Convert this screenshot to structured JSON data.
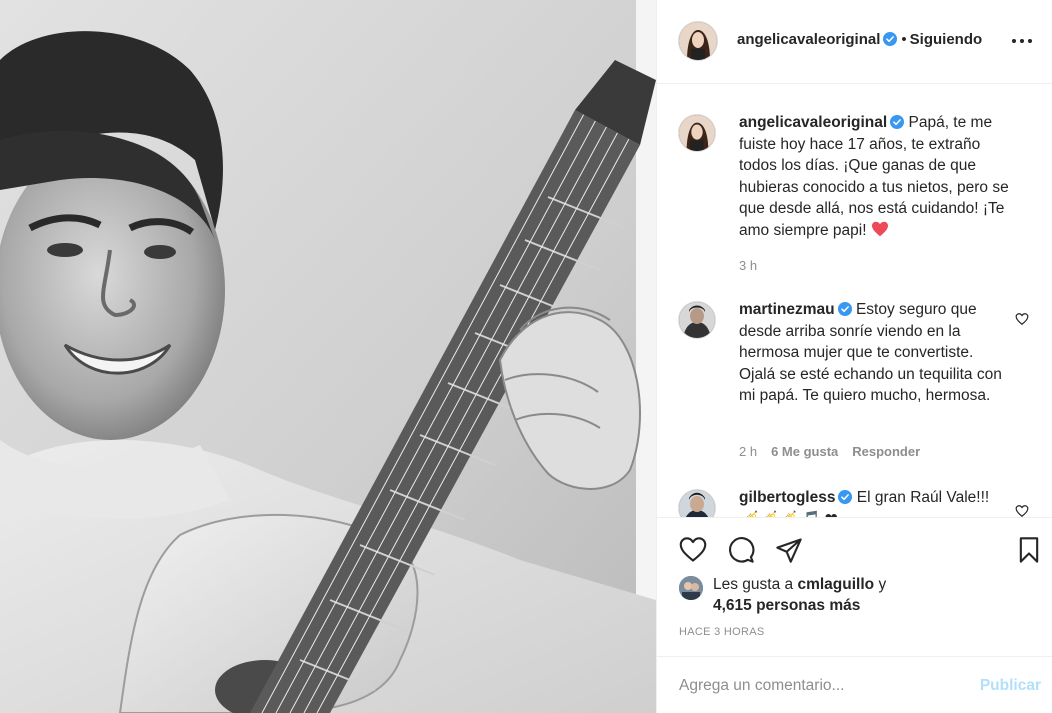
{
  "post": {
    "author": "angelicavaleoriginal",
    "follow_sep": "•",
    "follow_label": "Siguiendo",
    "caption": "Papá, te me fuiste hoy hace 17 años, te extraño todos los días. ¡Que ganas de que hubieras conocido a tus nietos, pero se que desde allá, nos está cuidando! ¡Te amo siempre papi!",
    "caption_time": "3 h"
  },
  "comments": [
    {
      "user": "martinezmau",
      "text": "Estoy seguro que desde arriba sonríe viendo en la hermosa mujer que te convertiste. Ojalá se esté echando un tequilita con mi papá. Te quiero mucho, hermosa.",
      "time": "2 h",
      "likes": "6 Me gusta",
      "reply": "Responder"
    },
    {
      "user": "gilbertogless",
      "text": "El gran Raúl",
      "truncated": "Vale!!! 🎺🎺🎺 🎵 ❤"
    }
  ],
  "likes": {
    "prefix": "Les gusta a",
    "user": "cmlaguillo",
    "and": "y",
    "count": "4,615 personas más"
  },
  "timestamp": "HACE 3 HORAS",
  "add_comment": {
    "placeholder": "Agrega un comentario...",
    "publish_label": "Publicar"
  },
  "icons": {
    "like": "heart-outline-icon",
    "comment": "comment-bubble-icon",
    "share": "paper-plane-icon",
    "save": "bookmark-icon",
    "more": "more-horizontal-icon",
    "verified": "verified-badge-icon"
  },
  "colors": {
    "verified": "#3897f0",
    "publish_disabled": "#b2dffc",
    "heart_emoji": "#ed4956"
  }
}
